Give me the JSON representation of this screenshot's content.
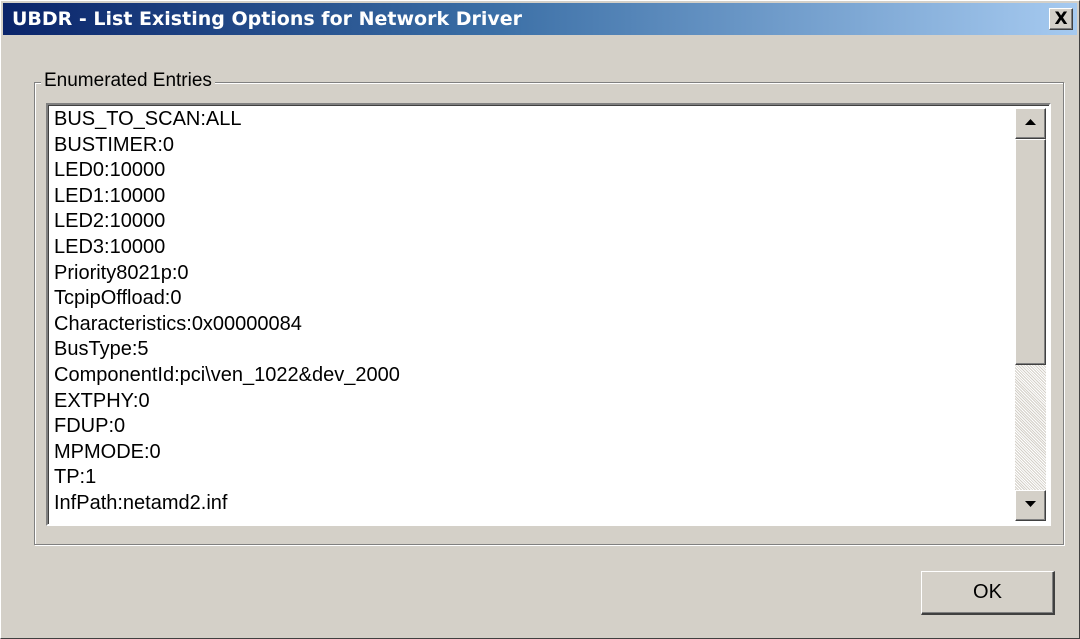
{
  "window": {
    "title": "UBDR - List Existing Options for Network Driver",
    "close_label": "X"
  },
  "group": {
    "label": "Enumerated Entries"
  },
  "list": {
    "items": [
      "BUS_TO_SCAN:ALL",
      "BUSTIMER:0",
      "LED0:10000",
      "LED1:10000",
      "LED2:10000",
      "LED3:10000",
      "Priority8021p:0",
      "TcpipOffload:0",
      "Characteristics:0x00000084",
      "BusType:5",
      "ComponentId:pci\\ven_1022&dev_2000",
      "EXTPHY:0",
      "FDUP:0",
      "MPMODE:0",
      "TP:1",
      "InfPath:netamd2.inf"
    ],
    "scroll": {
      "up_icon": "scroll-up-arrow-icon",
      "down_icon": "scroll-down-arrow-icon"
    }
  },
  "buttons": {
    "ok_label": "OK"
  },
  "colors": {
    "titlebar_start": "#0a246a",
    "titlebar_end": "#a6caf0",
    "face": "#d4d0c8"
  }
}
